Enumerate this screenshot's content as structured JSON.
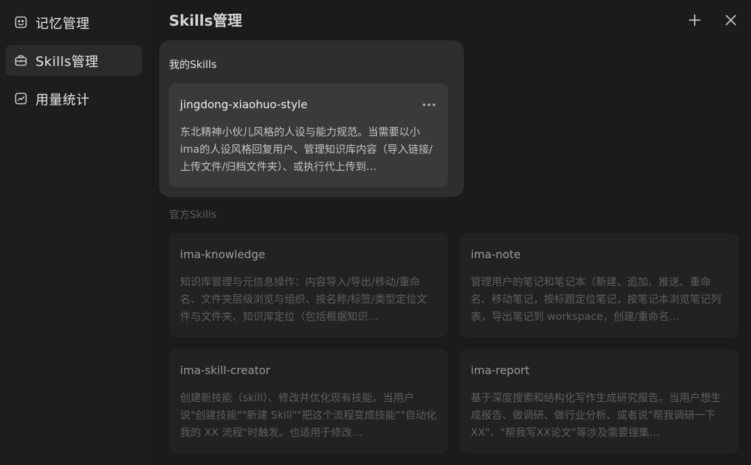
{
  "sidebar": {
    "items": [
      {
        "label": "记忆管理",
        "icon": "memory-icon"
      },
      {
        "label": "Skills管理",
        "icon": "toolbox-icon",
        "active": true
      },
      {
        "label": "用量统计",
        "icon": "chart-icon"
      }
    ]
  },
  "header": {
    "title": "Skills管理",
    "add_icon": "plus-icon",
    "close_icon": "close-icon"
  },
  "my_skills": {
    "title": "我的Skills",
    "items": [
      {
        "name": "jingdong-xiaohuo-style",
        "description": "东北精神小伙儿风格的人设与能力规范。当需要以小ima的人设风格回复用户、管理知识库内容（导入链接/上传文件/归档文件夹）、或执行代上传到…"
      }
    ]
  },
  "official_skills": {
    "title": "官方Skills",
    "items": [
      {
        "name": "ima-knowledge",
        "description": "知识库管理与元信息操作：内容导入/导出/移动/重命名、文件夹层级浏览与组织、按名称/标签/类型定位文件与文件夹、知识库定位（包括根据知识…"
      },
      {
        "name": "ima-note",
        "description": "管理用户的笔记和笔记本（新建、追加、推送、重命名、移动笔记，按标题定位笔记，按笔记本浏览笔记列表，导出笔记到 workspace，创建/重命名…"
      },
      {
        "name": "ima-skill-creator",
        "description": "创建新技能（skill）、修改并优化现有技能。当用户说\"创建技能\"\"新建 Skill\"\"把这个流程变成技能\"\"自动化我的 XX 流程\"时触发。也适用于修改…"
      },
      {
        "name": "ima-report",
        "description": "基于深度搜索和结构化写作生成研究报告。当用户想生成报告、做调研、做行业分析、或者说\"帮我调研一下XX\"、\"帮我写XX论文\"等涉及需要搜集…"
      }
    ]
  },
  "colors": {
    "background": "#1b1b1b",
    "sidebar": "#1d1d1d",
    "active_nav": "#2a2c2b",
    "panel": "#2e2e2e",
    "card": "#3a3a3a",
    "official_card": "#222222"
  }
}
